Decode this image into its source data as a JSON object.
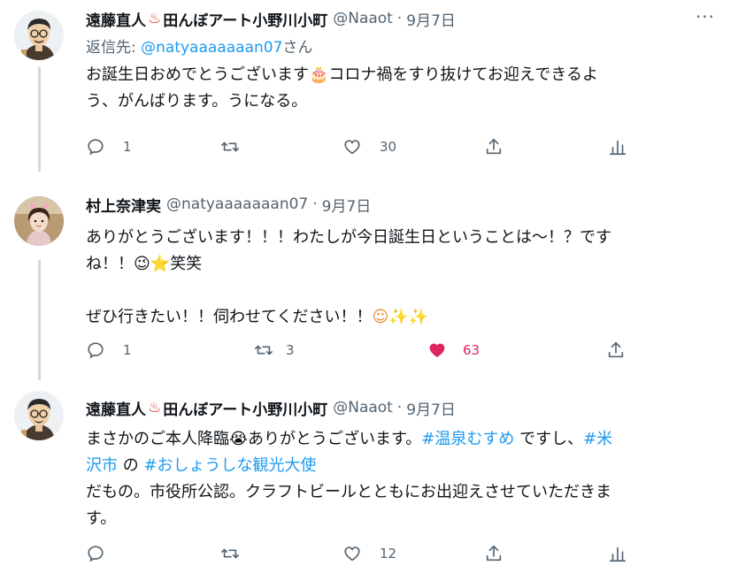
{
  "tweets": [
    {
      "name": "遠藤直人",
      "name_emoji": "♨",
      "name_suffix": "田んぼアート小野川小町",
      "handle": "@Naaot",
      "dot": "·",
      "date": "9月7日",
      "more": "···",
      "reply_prefix": "返信先: ",
      "reply_handle": "@natyaaaaaaan07",
      "reply_suffix": "さん",
      "body_line1_a": "お誕生日おめでとうございます",
      "body_emoji1": "🎂",
      "body_line1_b": "コロナ禍をすり抜けてお迎えできるよ",
      "body_line2": "う、がんばります。うになる。",
      "reply_count": "1",
      "retweet_count": "",
      "like_count": "30"
    },
    {
      "name": "村上奈津実",
      "handle": "@natyaaaaaaan07",
      "dot": "·",
      "date": "9月7日",
      "body_line1": "ありがとうございます！！！わたしが今日誕生日ということは〜！？です",
      "body_line2_a": "ね！！",
      "body_emoji_a": "😉",
      "body_emoji_b": "⭐",
      "body_line2_b": "笑笑",
      "body_line3_a": "ぜひ行きたい！！伺わせてください！！",
      "body_emoji_c": "☺",
      "body_emoji_d": "✨",
      "body_emoji_e": "✨",
      "reply_count": "1",
      "retweet_count": "3",
      "like_count": "63"
    },
    {
      "name": "遠藤直人",
      "name_emoji": "♨",
      "name_suffix": "田んぼアート小野川小町",
      "handle": "@Naaot",
      "dot": "·",
      "date": "9月7日",
      "body_a": "まさかのご本人降臨",
      "body_emoji": "😭",
      "body_b": "ありがとうございます。",
      "hashtag1": "#温泉むすめ",
      "body_c": " ですし、",
      "hashtag2_a": "#米",
      "hashtag2_b": "沢市",
      "body_d": " の ",
      "hashtag3": "#おしょうしな観光大使",
      "body_line3": "だもの。市役所公認。クラフトビールとともにお出迎えさせていただきま",
      "body_line4": "す。",
      "reply_count": "",
      "retweet_count": "",
      "like_count": "12"
    }
  ],
  "icons": [
    "reply-icon",
    "retweet-icon",
    "like-icon",
    "share-icon",
    "analytics-icon",
    "more-icon"
  ],
  "colors": {
    "accent": "#1d9bf0",
    "muted": "#536471",
    "like": "#e0245e",
    "thread": "#cfd9de"
  }
}
